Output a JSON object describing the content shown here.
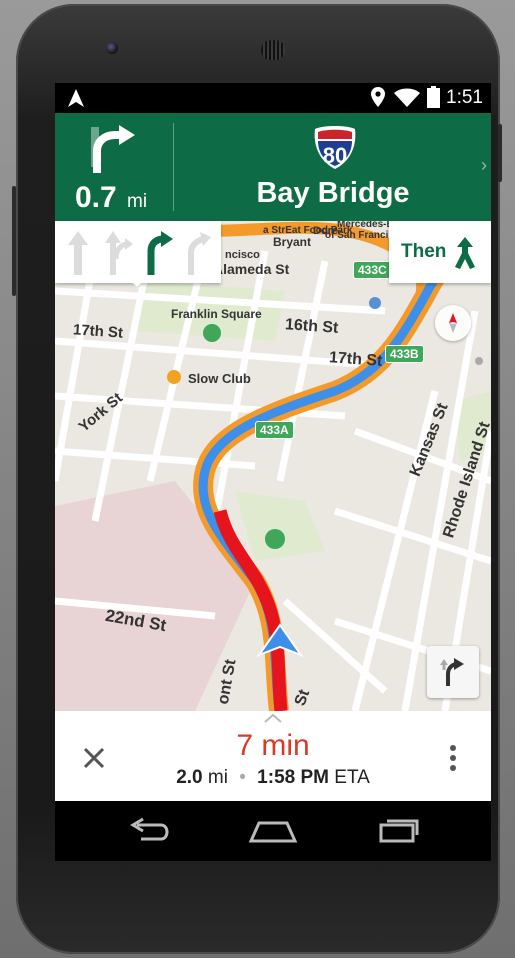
{
  "status_bar": {
    "time": "1:51",
    "icons": [
      "navigation-arrow-icon",
      "location-pin-icon",
      "wifi-icon",
      "battery-icon"
    ]
  },
  "nav_header": {
    "turn_icon": "turn-right-icon",
    "distance": "0.7",
    "distance_unit": "mi",
    "shield_number": "80",
    "road_name": "Bay Bridge",
    "next_icon": "chevron-right-icon",
    "colors": {
      "header_bg": "#0d6b45",
      "shield_blue": "#1d3f8f",
      "shield_red": "#c9252c"
    }
  },
  "lanes": {
    "count": 4,
    "recommended_lane": 3,
    "lane_icons": [
      "straight-arrow-icon",
      "straight-right-arrow-icon",
      "turn-right-arrow-icon",
      "slight-right-arrow-icon"
    ]
  },
  "then": {
    "label": "Then",
    "icon": "keep-left-fork-icon"
  },
  "map": {
    "labels": {
      "franklin_square": "Franklin Square",
      "slow_club": "Slow Club",
      "seventeenth_st": "17th St",
      "sixteenth_st": "16th St",
      "seventeenth_st_2": "17th St",
      "york_st": "York St",
      "kansas_st": "Kansas St",
      "rhode_island_st": "Rhode Island St",
      "twentysecond_st": "22nd St",
      "alameda_st": "Alameda St",
      "bryant": "Bryant",
      "mercedes": "Mercedes-Be",
      "of_san_francisco": "of San Francisco",
      "streat_food": "a StrEat Food Park",
      "ncisco": "ncisco",
      "dore": "Dore",
      "ont_st": "ont St",
      "st_bottom": "St"
    },
    "exits": {
      "e433c": "433C",
      "e433b": "433B",
      "e433a": "433A"
    },
    "route_colors": {
      "blue": "#3d8fea",
      "orange": "#f39a2b",
      "red": "#e5141d"
    },
    "compass_icon": "compass-icon",
    "reroute_icon": "alternate-route-icon",
    "location_icon": "navigation-arrow-icon"
  },
  "bottom_bar": {
    "expand_icon": "chevron-up-icon",
    "close_icon": "close-icon",
    "minutes": "7 min",
    "distance_value": "2.0",
    "distance_unit": "mi",
    "separator": "•",
    "eta_time": "1:58 PM",
    "eta_label": "ETA",
    "more_icon": "more-vertical-icon"
  },
  "android_nav": {
    "back_icon": "back-icon",
    "home_icon": "home-icon",
    "recents_icon": "recents-icon"
  }
}
